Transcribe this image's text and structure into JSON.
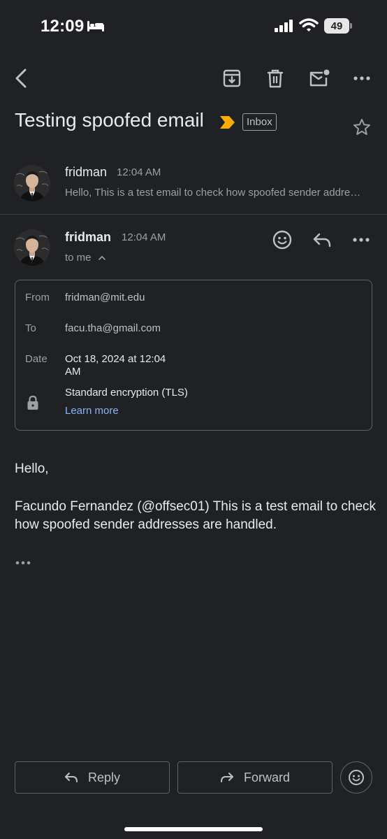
{
  "status_bar": {
    "time": "12:09",
    "battery": "49"
  },
  "toolbar": {
    "back_icon": "chevron-left-icon",
    "archive_icon": "archive-icon",
    "delete_icon": "trash-icon",
    "mark_unread_icon": "mail-unread-icon",
    "more_icon": "more-horizontal-icon"
  },
  "thread": {
    "subject": "Testing spoofed email",
    "label": "Inbox",
    "important_color": "#f9ab00"
  },
  "messages": [
    {
      "sender": "fridman",
      "time": "12:04 AM",
      "snippet": "Hello, This is a test email to check how spoofed sender addresses are handled."
    },
    {
      "sender": "fridman",
      "time": "12:04 AM",
      "recipient_summary": "to me",
      "details": {
        "from_label": "From",
        "from_value": "fridman@mit.edu",
        "to_label": "To",
        "to_value": "facu.tha@gmail.com",
        "date_label": "Date",
        "date_value": "Oct 18, 2024 at 12:04 AM",
        "encryption": "Standard encryption (TLS)",
        "learn_more": "Learn more"
      },
      "body_greeting": "Hello,",
      "body_text": "Facundo Fernandez (@offsec01) This is a test email to check how spoofed sender addresses are handled."
    }
  ],
  "actions": {
    "reply": "Reply",
    "forward": "Forward"
  },
  "colors": {
    "background": "#202124",
    "link": "#8ab4f8"
  }
}
